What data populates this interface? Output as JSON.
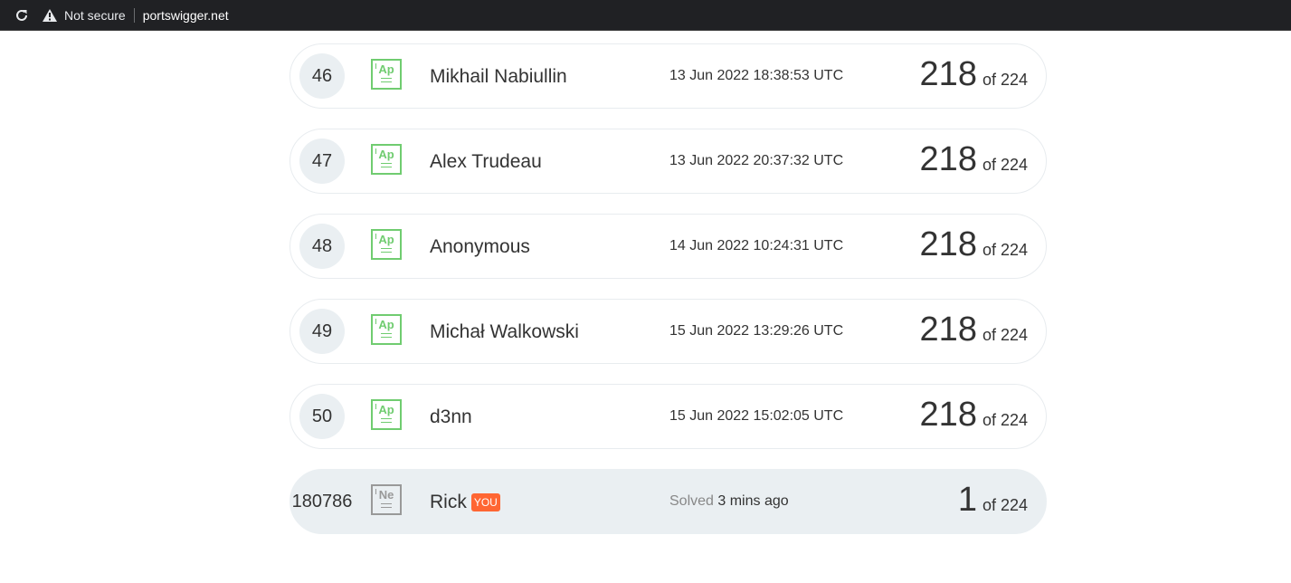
{
  "browser": {
    "security_label": "Not secure",
    "url": "portswigger.net"
  },
  "leaderboard": {
    "rows": [
      {
        "rank": "46",
        "badge": "Ap",
        "name": "Mikhail Nabiullin",
        "date": "13 Jun 2022 18:38:53 UTC",
        "score": "218",
        "total": "of 224"
      },
      {
        "rank": "47",
        "badge": "Ap",
        "name": "Alex Trudeau",
        "date": "13 Jun 2022 20:37:32 UTC",
        "score": "218",
        "total": "of 224"
      },
      {
        "rank": "48",
        "badge": "Ap",
        "name": "Anonymous",
        "date": "14 Jun 2022 10:24:31 UTC",
        "score": "218",
        "total": "of 224"
      },
      {
        "rank": "49",
        "badge": "Ap",
        "name": "Michał Walkowski",
        "date": "15 Jun 2022 13:29:26 UTC",
        "score": "218",
        "total": "of 224"
      },
      {
        "rank": "50",
        "badge": "Ap",
        "name": "d3nn",
        "date": "15 Jun 2022 15:02:05 UTC",
        "score": "218",
        "total": "of 224"
      }
    ],
    "current_user": {
      "rank": "180786",
      "badge": "Ne",
      "name": "Rick",
      "you_tag": "YOU",
      "solved_label": "Solved",
      "solved_time": "3 mins ago",
      "score": "1",
      "total": "of 224"
    }
  },
  "colors": {
    "badge_green": "#70cc70",
    "badge_grey": "#999999",
    "you_tag": "#ff6633",
    "highlight_row": "#eaeff2"
  },
  "icons": {
    "reload": "reload-icon",
    "warning": "warning-icon"
  }
}
